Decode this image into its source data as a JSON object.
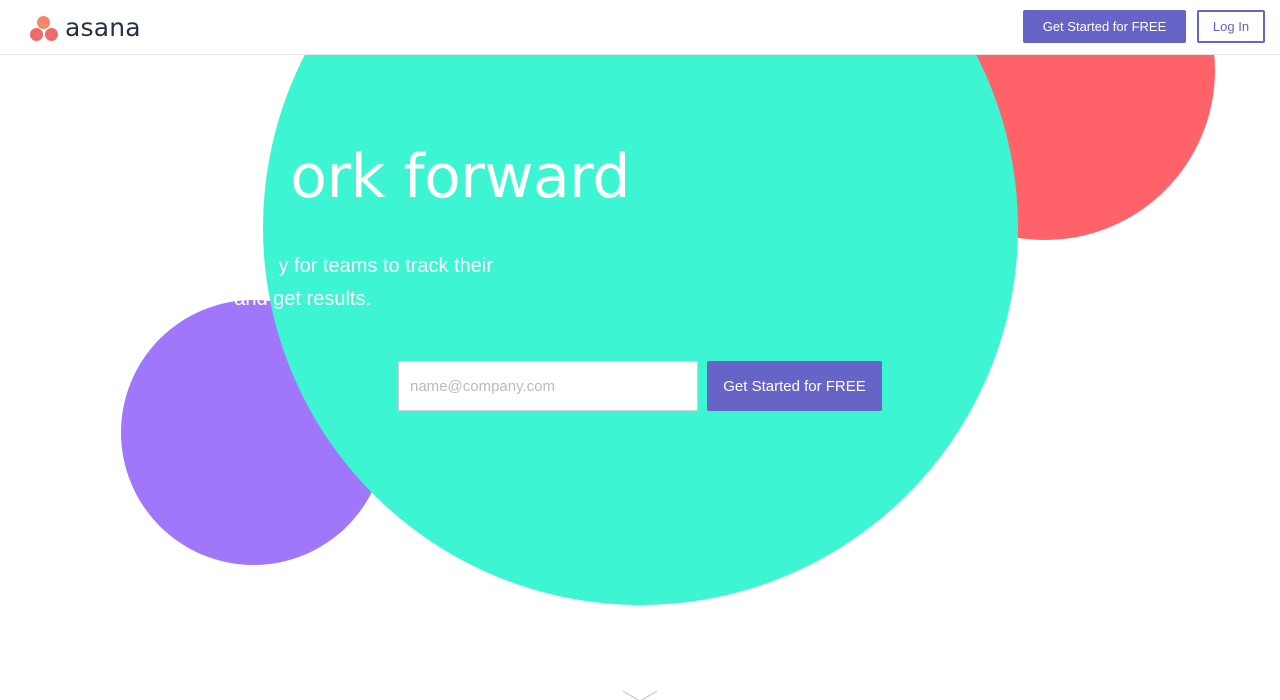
{
  "header": {
    "logo_text": "asana",
    "cta_label": "Get Started for FREE",
    "login_label": "Log In"
  },
  "hero": {
    "headline_visible": "ork forward",
    "subhead_line1_visible": "y for teams to track their",
    "subhead_line2_visible": "and get results.",
    "email_placeholder": "name@company.com",
    "cta_label": "Get Started for FREE"
  },
  "icons": {
    "logo": "asana-logo-icon",
    "scroll": "chevron-down-icon"
  },
  "colors": {
    "brand_purple": "#6863c7",
    "teal": "#3ef5d3",
    "coral": "#ff6268",
    "violet": "#a077fb",
    "logo_coral": "#f06a6a"
  }
}
